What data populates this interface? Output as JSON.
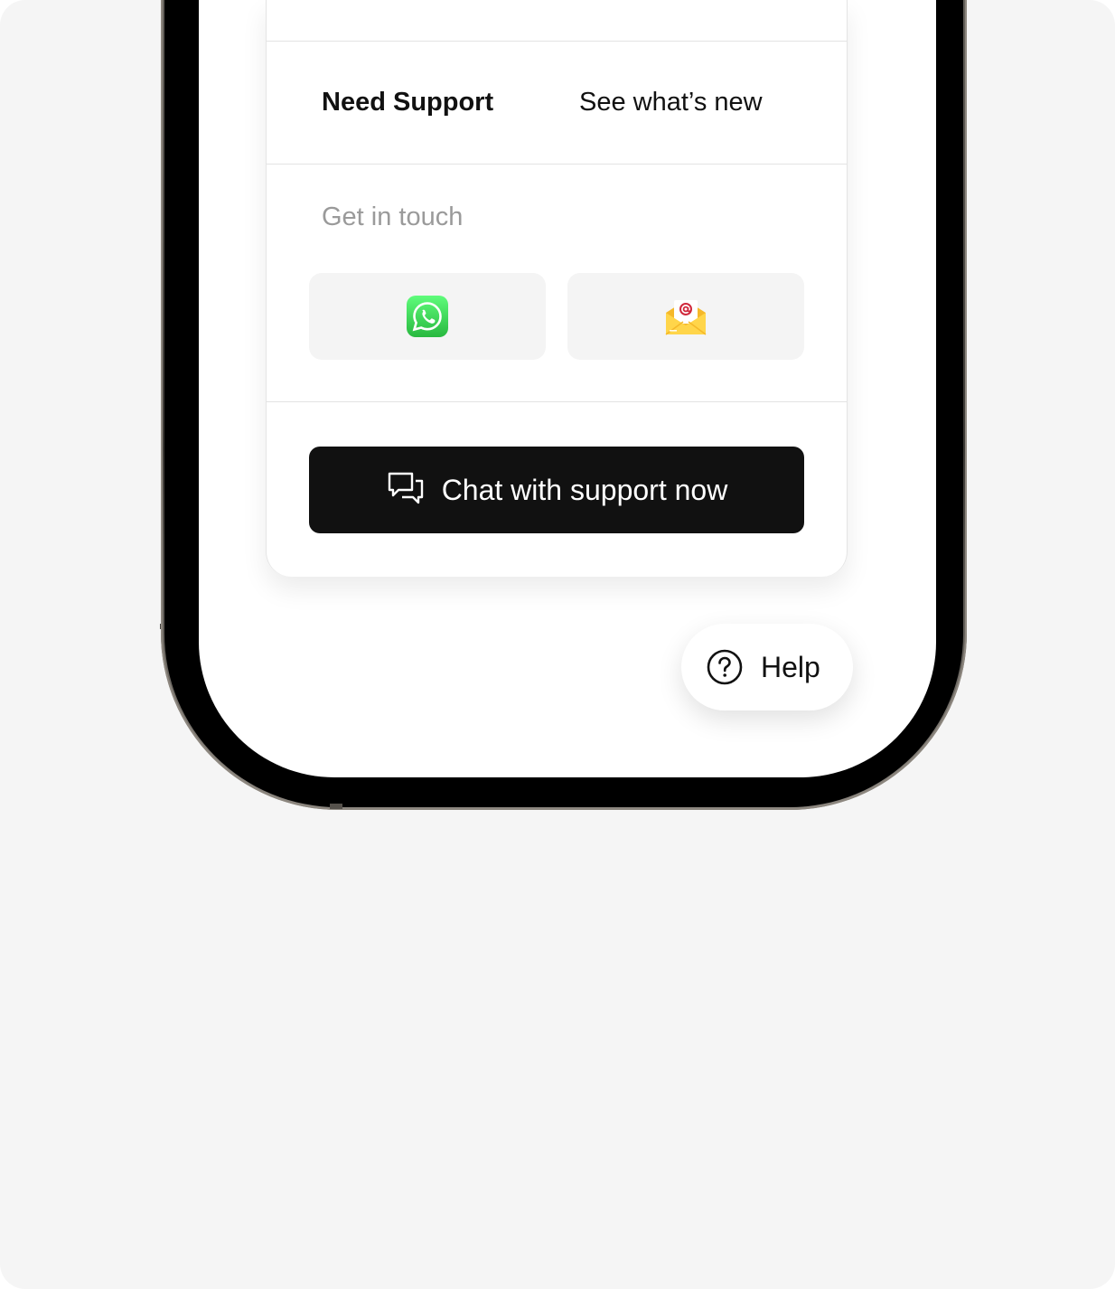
{
  "support_card": {
    "tabs": [
      {
        "label": "Need Support",
        "active": true
      },
      {
        "label": "See what’s new",
        "active": false
      }
    ],
    "get_in_touch_label": "Get in touch",
    "contact_options": [
      {
        "name": "whatsapp",
        "icon": "whatsapp-icon",
        "color": "#25D366"
      },
      {
        "name": "email",
        "icon": "email-envelope-icon",
        "color": "#F7C23C"
      }
    ],
    "chat_button_label": "Chat with support now"
  },
  "help_fab": {
    "label": "Help",
    "icon": "question-circle-icon"
  }
}
